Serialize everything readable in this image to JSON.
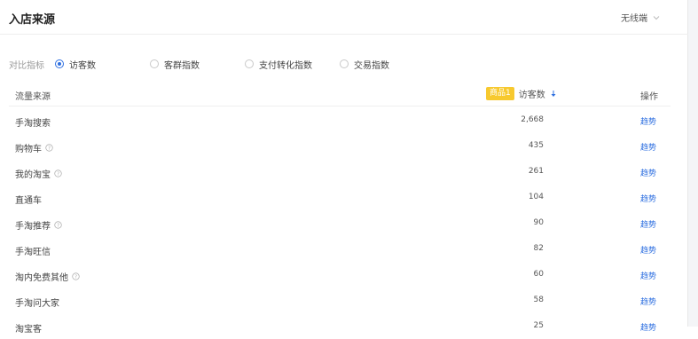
{
  "panel": {
    "title": "入店来源",
    "device_select": "无线端"
  },
  "metric_selector": {
    "label": "对比指标",
    "options": [
      {
        "label": "访客数",
        "checked": true
      },
      {
        "label": "客群指数",
        "checked": false
      },
      {
        "label": "支付转化指数",
        "checked": false
      },
      {
        "label": "交易指数",
        "checked": false
      }
    ]
  },
  "table": {
    "col_source": "流量来源",
    "badge": "商品1",
    "col_metric": "访客数",
    "col_action": "操作",
    "rows": [
      {
        "name": "手淘搜索",
        "value": "2,668",
        "action": "趋势"
      },
      {
        "name": "购物车",
        "value": "435",
        "action": "趋势"
      },
      {
        "name": "我的淘宝",
        "value": "261",
        "action": "趋势"
      },
      {
        "name": "直通车",
        "value": "104",
        "action": "趋势"
      },
      {
        "name": "手淘推荐",
        "value": "90",
        "action": "趋势"
      },
      {
        "name": "手淘旺信",
        "value": "82",
        "action": "趋势"
      },
      {
        "name": "淘内免费其他",
        "value": "60",
        "action": "趋势"
      },
      {
        "name": "手淘问大家",
        "value": "58",
        "action": "趋势"
      },
      {
        "name": "淘宝客",
        "value": "25",
        "action": "趋势"
      }
    ]
  },
  "colors": {
    "accent": "#2e6fe0",
    "badge": "#f7c92f"
  }
}
